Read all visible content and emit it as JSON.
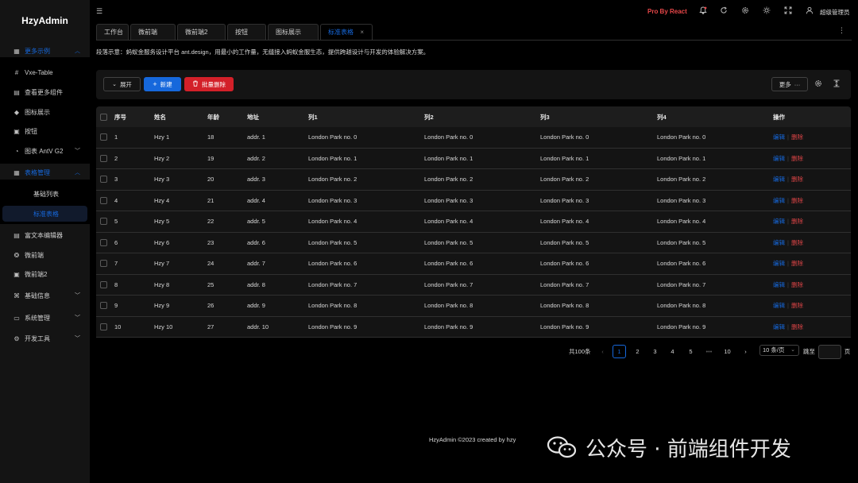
{
  "app": {
    "title": "HzyAdmin"
  },
  "sidebar": {
    "items": [
      {
        "label": "更多示例",
        "icon": "appstore-icon",
        "type": "group-open"
      },
      {
        "label": "Vxe-Table",
        "icon": "grid-icon",
        "type": "item"
      },
      {
        "label": "查看更多组件",
        "icon": "file-icon",
        "type": "item"
      },
      {
        "label": "图标展示",
        "icon": "diamond-icon",
        "type": "item"
      },
      {
        "label": "按钮",
        "icon": "square-icon",
        "type": "item"
      },
      {
        "label": "图表 AntV G2",
        "icon": "pie-chart-icon",
        "type": "group-closed"
      },
      {
        "label": "表格管理",
        "icon": "table-icon",
        "type": "group-open"
      },
      {
        "label": "基础列表",
        "type": "sub"
      },
      {
        "label": "标准表格",
        "type": "sub-selected"
      },
      {
        "label": "富文本编辑器",
        "icon": "editor-icon",
        "type": "item"
      },
      {
        "label": "微前端",
        "icon": "cluster-icon",
        "type": "item"
      },
      {
        "label": "微前端2",
        "icon": "frame-icon",
        "type": "item"
      },
      {
        "label": "基础信息",
        "icon": "apartment-icon",
        "type": "group-closed"
      },
      {
        "label": "系统管理",
        "icon": "desktop-icon",
        "type": "group-closed"
      },
      {
        "label": "开发工具",
        "icon": "tool-icon",
        "type": "group-closed"
      }
    ]
  },
  "header": {
    "pro_label": "Pro By React",
    "username": "超级管理员"
  },
  "tabs": [
    {
      "label": "工作台",
      "active": false
    },
    {
      "label": "微前端",
      "active": false
    },
    {
      "label": "微前端2",
      "active": false
    },
    {
      "label": "按钮",
      "active": false
    },
    {
      "label": "图标展示",
      "active": false
    },
    {
      "label": "标准表格",
      "active": true
    }
  ],
  "description": "段落示意：蚂蚁金服务设计平台 ant.design，用最小的工作量，无缝接入蚂蚁金服生态，提供跨越设计与开发的体验解决方案。",
  "toolbar": {
    "expand_label": "展开",
    "new_label": "新建",
    "batch_delete_label": "批量删除",
    "more_label": "更多"
  },
  "table": {
    "columns": [
      "序号",
      "姓名",
      "年龄",
      "地址",
      "列1",
      "列2",
      "列3",
      "列4",
      "操作"
    ],
    "rows": [
      {
        "no": "1",
        "name": "Hzy 1",
        "age": "18",
        "addr": "addr. 1",
        "c1": "London Park no. 0",
        "c2": "London Park no. 0",
        "c3": "London Park no. 0",
        "c4": "London Park no. 0"
      },
      {
        "no": "2",
        "name": "Hzy 2",
        "age": "19",
        "addr": "addr. 2",
        "c1": "London Park no. 1",
        "c2": "London Park no. 1",
        "c3": "London Park no. 1",
        "c4": "London Park no. 1"
      },
      {
        "no": "3",
        "name": "Hzy 3",
        "age": "20",
        "addr": "addr. 3",
        "c1": "London Park no. 2",
        "c2": "London Park no. 2",
        "c3": "London Park no. 2",
        "c4": "London Park no. 2"
      },
      {
        "no": "4",
        "name": "Hzy 4",
        "age": "21",
        "addr": "addr. 4",
        "c1": "London Park no. 3",
        "c2": "London Park no. 3",
        "c3": "London Park no. 3",
        "c4": "London Park no. 3"
      },
      {
        "no": "5",
        "name": "Hzy 5",
        "age": "22",
        "addr": "addr. 5",
        "c1": "London Park no. 4",
        "c2": "London Park no. 4",
        "c3": "London Park no. 4",
        "c4": "London Park no. 4"
      },
      {
        "no": "6",
        "name": "Hzy 6",
        "age": "23",
        "addr": "addr. 6",
        "c1": "London Park no. 5",
        "c2": "London Park no. 5",
        "c3": "London Park no. 5",
        "c4": "London Park no. 5"
      },
      {
        "no": "7",
        "name": "Hzy 7",
        "age": "24",
        "addr": "addr. 7",
        "c1": "London Park no. 6",
        "c2": "London Park no. 6",
        "c3": "London Park no. 6",
        "c4": "London Park no. 6"
      },
      {
        "no": "8",
        "name": "Hzy 8",
        "age": "25",
        "addr": "addr. 8",
        "c1": "London Park no. 7",
        "c2": "London Park no. 7",
        "c3": "London Park no. 7",
        "c4": "London Park no. 7"
      },
      {
        "no": "9",
        "name": "Hzy 9",
        "age": "26",
        "addr": "addr. 9",
        "c1": "London Park no. 8",
        "c2": "London Park no. 8",
        "c3": "London Park no. 8",
        "c4": "London Park no. 8"
      },
      {
        "no": "10",
        "name": "Hzy 10",
        "age": "27",
        "addr": "addr. 10",
        "c1": "London Park no. 9",
        "c2": "London Park no. 9",
        "c3": "London Park no. 9",
        "c4": "London Park no. 9"
      }
    ],
    "edit_label": "编辑",
    "delete_label": "删除"
  },
  "pagination": {
    "total_label": "共100条",
    "pages": [
      "1",
      "2",
      "3",
      "4",
      "5",
      "•••",
      "10"
    ],
    "current": "1",
    "page_size_label": "10 条/页",
    "goto_label": "跳至",
    "page_suffix": "页"
  },
  "footer": {
    "text": "HzyAdmin ©2023 created by hzy"
  },
  "watermark": {
    "text": "公众号 · 前端组件开发"
  }
}
